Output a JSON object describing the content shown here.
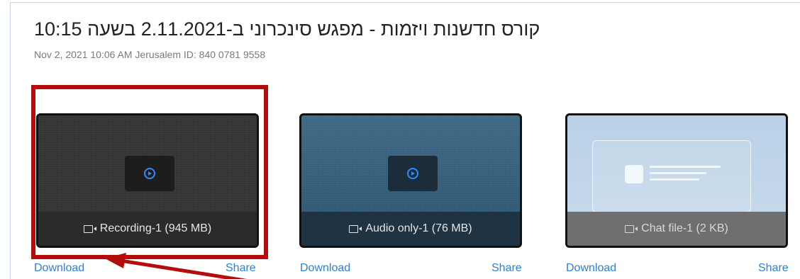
{
  "meeting": {
    "title": "קורס חדשנות ויזמות - מפגש סינכרוני ב-2.11.2021 בשעה 10:15",
    "meta": "Nov 2, 2021 10:06 AM Jerusalem   ID: 840 0781 9558"
  },
  "files": [
    {
      "label": "Recording-1 (945 MB)",
      "icon": "video-icon",
      "download": "Download",
      "share": "Share"
    },
    {
      "label": "Audio only-1 (76 MB)",
      "icon": "video-icon",
      "download": "Download",
      "share": "Share"
    },
    {
      "label": "Chat file-1 (2 KB)",
      "icon": "video-icon",
      "download": "Download",
      "share": "Share"
    }
  ],
  "colors": {
    "link": "#2f80d6",
    "highlight": "#b50d0d",
    "accent": "#2d8cff"
  }
}
